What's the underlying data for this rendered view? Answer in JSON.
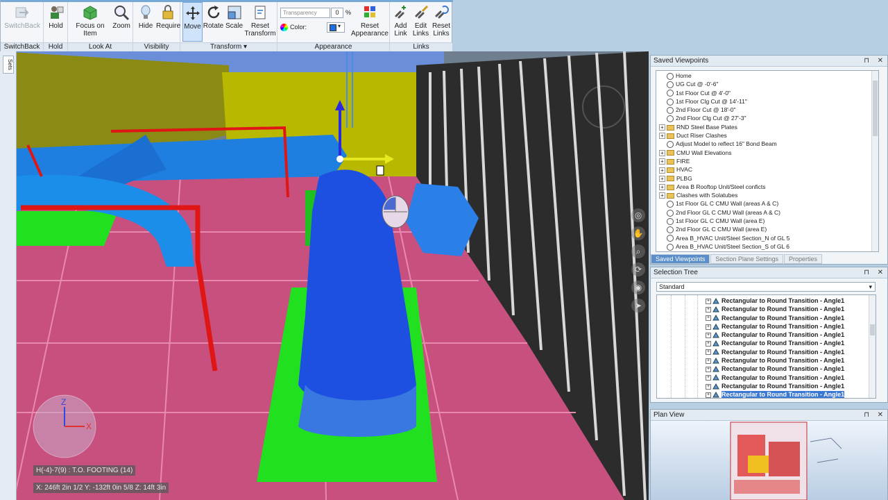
{
  "ribbon": {
    "groups": [
      {
        "label": "SwitchBack",
        "buttons": [
          {
            "label": "SwitchBack",
            "icon": "switchback-icon",
            "state": "disabled"
          }
        ]
      },
      {
        "label": "Hold",
        "buttons": [
          {
            "label": "Hold",
            "icon": "hold-icon"
          }
        ]
      },
      {
        "label": "Look At",
        "buttons": [
          {
            "label": "Focus on Item",
            "icon": "focus-icon"
          },
          {
            "label": "Zoom",
            "icon": "zoom-icon"
          }
        ]
      },
      {
        "label": "Visibility",
        "buttons": [
          {
            "label": "Hide",
            "icon": "hide-icon"
          },
          {
            "label": "Require",
            "icon": "require-icon"
          }
        ]
      },
      {
        "label": "Transform",
        "buttons": [
          {
            "label": "Move",
            "icon": "move-icon",
            "state": "active"
          },
          {
            "label": "Rotate",
            "icon": "rotate-icon"
          },
          {
            "label": "Scale",
            "icon": "scale-icon"
          },
          {
            "label": "Reset Transform",
            "icon": "reset-transform-icon"
          }
        ]
      },
      {
        "label": "Appearance",
        "buttons": [
          {
            "label": "Reset Appearance",
            "icon": "reset-appearance-icon"
          }
        ]
      },
      {
        "label": "Links",
        "buttons": [
          {
            "label": "Add Link",
            "icon": "add-link-icon"
          },
          {
            "label": "Edit Links",
            "icon": "edit-links-icon"
          },
          {
            "label": "Reset Links",
            "icon": "reset-links-icon"
          }
        ]
      }
    ],
    "transparency": {
      "label": "Transparency",
      "value": "0",
      "unit": "%"
    },
    "color": {
      "label": "Color:",
      "swatch": "#1f6fe0"
    }
  },
  "viewport": {
    "side_tab": "Sets",
    "grid_label": "H(-4)-7(9) : T.O. FOOTING (14)",
    "coords": "X: 246ft 2in 1/2  Y: -132ft 0in 5/8  Z: 14ft 3in",
    "axis": {
      "z": "Z",
      "x": "X"
    }
  },
  "saved_viewpoints": {
    "title": "Saved Viewpoints",
    "items": [
      {
        "label": "Home",
        "kind": "view"
      },
      {
        "label": "UG Cut @ -0'-6\"",
        "kind": "view"
      },
      {
        "label": "1st Floor Cut @ 4'-0\"",
        "kind": "view"
      },
      {
        "label": "1st Floor Clg Cut @ 14'-11\"",
        "kind": "view"
      },
      {
        "label": "2nd Floor Cut @ 18'-0\"",
        "kind": "view"
      },
      {
        "label": "2nd Floor Clg Cut @ 27'-3\"",
        "kind": "view"
      },
      {
        "label": "RND Steel Base Plates",
        "kind": "folder"
      },
      {
        "label": "Duct Riser Clashes",
        "kind": "folder"
      },
      {
        "label": "Adjust Model to reflect 16\" Bond Beam",
        "kind": "view"
      },
      {
        "label": "CMU Wall Elevations",
        "kind": "folder"
      },
      {
        "label": "FIRE",
        "kind": "folder"
      },
      {
        "label": "HVAC",
        "kind": "folder"
      },
      {
        "label": "PLBG",
        "kind": "folder"
      },
      {
        "label": "Area B Rooftop Unit/Steel conficts",
        "kind": "folder"
      },
      {
        "label": "Clashes with Solatubes",
        "kind": "folder"
      },
      {
        "label": "1st Floor GL C CMU Wall (areas A & C)",
        "kind": "view"
      },
      {
        "label": "2nd Floor GL C CMU Wall (areas A & C)",
        "kind": "view"
      },
      {
        "label": "1st Floor GL C CMU Wall (area E)",
        "kind": "view"
      },
      {
        "label": "2nd Floor GL C CMU Wall (area E)",
        "kind": "view"
      },
      {
        "label": "Area B_HVAC Unit/Steel Section_N of GL 5",
        "kind": "view"
      },
      {
        "label": "Area B_HVAC Unit/Steel Section_S of GL 6",
        "kind": "view"
      }
    ],
    "tabs": [
      "Saved Viewpoints",
      "Section Plane Settings",
      "Properties"
    ]
  },
  "selection_tree": {
    "title": "Selection Tree",
    "mode": "Standard",
    "rows": [
      "Rectangular to Round Transition - Angle1",
      "Rectangular to Round Transition - Angle1",
      "Rectangular to Round Transition - Angle1",
      "Rectangular to Round Transition - Angle1",
      "Rectangular to Round Transition - Angle1",
      "Rectangular to Round Transition - Angle1",
      "Rectangular to Round Transition - Angle1",
      "Rectangular to Round Transition - Angle1",
      "Rectangular to Round Transition - Angle1",
      "Rectangular to Round Transition - Angle1",
      "Rectangular to Round Transition - Angle1",
      "Rectangular to Round Transition - Angle1"
    ],
    "selected_index": 11
  },
  "plan_view": {
    "title": "Plan View"
  },
  "colors": {
    "accent": "#3a78d4",
    "duct": "#1d4fe0",
    "pipe": "#e01515",
    "floor": "#c8507f",
    "pad": "#20e020"
  }
}
